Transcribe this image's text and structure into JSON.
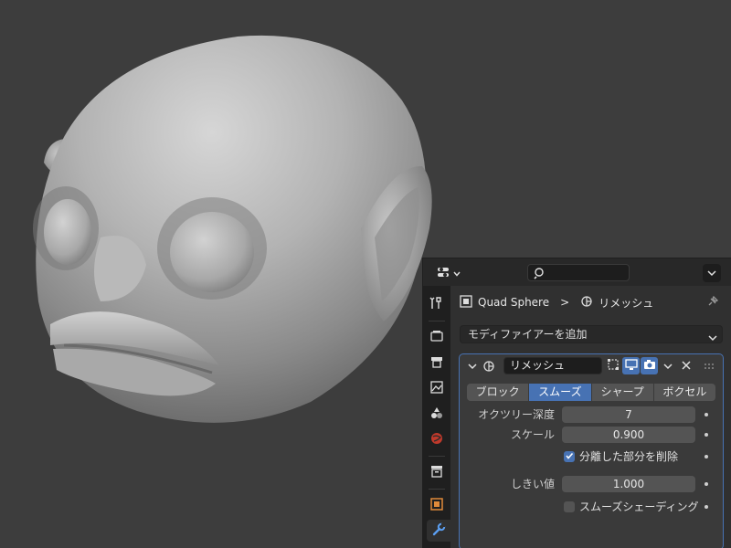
{
  "viewport": {
    "object_name": "3d-sculpt-head"
  },
  "header": {
    "editor_type_icon": "properties-editor-icon",
    "search_placeholder": "",
    "options_icon": "chevron-down-icon"
  },
  "tabs": [
    {
      "name": "tab-tool",
      "icon": "tool-icon"
    },
    {
      "name": "tab-render",
      "icon": "render-icon"
    },
    {
      "name": "tab-output",
      "icon": "output-icon"
    },
    {
      "name": "tab-view-layer",
      "icon": "view-layer-icon"
    },
    {
      "name": "tab-scene",
      "icon": "scene-icon"
    },
    {
      "name": "tab-world",
      "icon": "world-icon"
    },
    {
      "name": "tab-collection",
      "icon": "collection-icon"
    },
    {
      "name": "tab-object",
      "icon": "object-icon"
    },
    {
      "name": "tab-modifiers",
      "icon": "wrench-icon",
      "active": true
    }
  ],
  "breadcrumb": {
    "object": "Quad Sphere",
    "separator": ">",
    "modifier": "リメッシュ"
  },
  "add_modifier": {
    "label": "モディファイアーを追加"
  },
  "modifier": {
    "name": "リメッシュ",
    "modes": [
      {
        "label": "ブロック",
        "selected": false
      },
      {
        "label": "スムーズ",
        "selected": true
      },
      {
        "label": "シャープ",
        "selected": false
      },
      {
        "label": "ボクセル",
        "selected": false
      }
    ],
    "octree_depth": {
      "label": "オクツリー深度",
      "value": "7"
    },
    "scale": {
      "label": "スケール",
      "value": "0.900"
    },
    "remove_disconnected": {
      "label": "分離した部分を削除",
      "checked": true
    },
    "threshold": {
      "label": "しきい値",
      "value": "1.000"
    },
    "smooth_shading": {
      "label": "スムーズシェーディング",
      "checked": false
    }
  },
  "colors": {
    "accent": "#4772b3",
    "panel": "#303030",
    "viewport": "#3d3d3d"
  }
}
